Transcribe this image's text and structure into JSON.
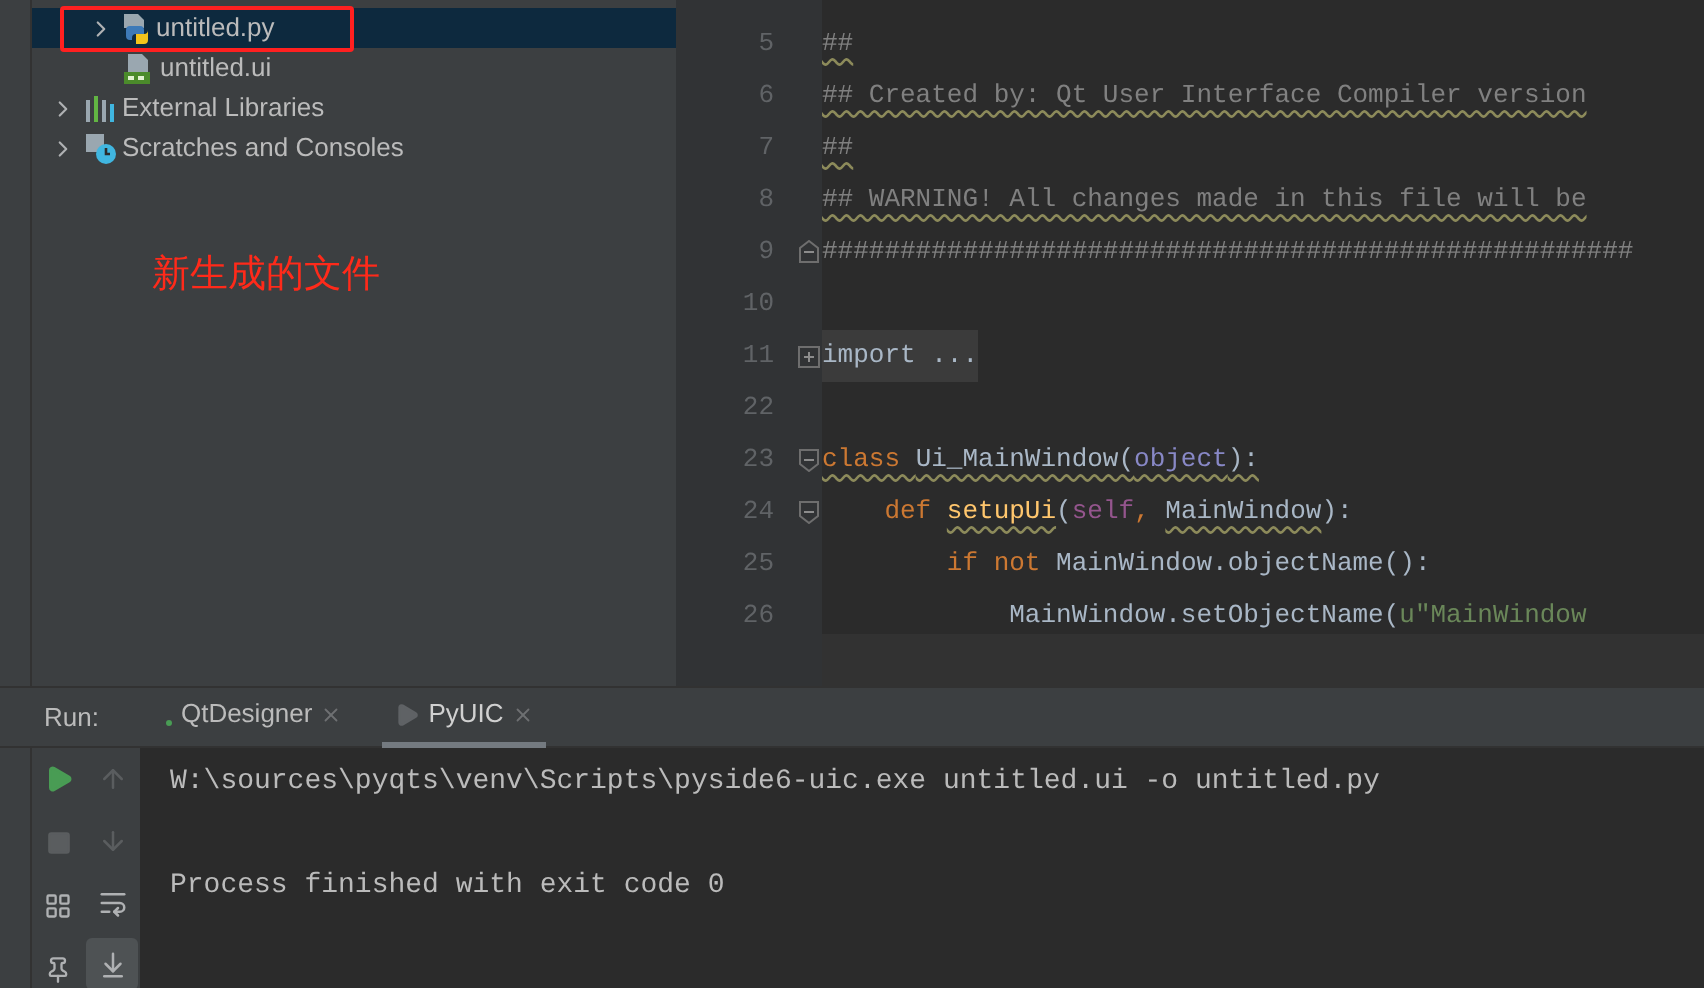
{
  "project_tree": {
    "nested_items": [
      {
        "label": "untitled.py",
        "kind": "python",
        "expanded": false,
        "selected": true,
        "boxed": true
      },
      {
        "label": "untitled.ui",
        "kind": "qt",
        "selected": false,
        "boxed": false
      }
    ],
    "root_items": [
      {
        "label": "External Libraries",
        "kind": "libraries",
        "expanded": false,
        "selected": false,
        "boxed": false
      },
      {
        "label": "Scratches and Consoles",
        "kind": "scratches",
        "expanded": false,
        "selected": false,
        "boxed": false
      }
    ]
  },
  "annotation": {
    "text": "新生成的文件",
    "color": "#ff2a1a"
  },
  "editor": {
    "lines": [
      {
        "number": "5",
        "kind": "plain",
        "tokens": [
          {
            "text": "##",
            "kind": "comment",
            "squiggle": true
          }
        ]
      },
      {
        "number": "6",
        "kind": "plain",
        "tokens": [
          {
            "text": "## Created by: Qt User Interface Compiler version",
            "kind": "comment",
            "squiggle": true
          }
        ]
      },
      {
        "number": "7",
        "kind": "plain",
        "tokens": [
          {
            "text": "##",
            "kind": "comment",
            "squiggle": true
          }
        ]
      },
      {
        "number": "8",
        "kind": "plain",
        "tokens": [
          {
            "text": "## WARNING! All changes made in this file will be",
            "kind": "comment",
            "squiggle": true
          }
        ]
      },
      {
        "number": "9",
        "kind": "fold_end",
        "tokens": [
          {
            "text": "####################################################",
            "kind": "comment",
            "squiggle": false
          }
        ]
      },
      {
        "number": "10",
        "kind": "plain"
      },
      {
        "number": "11",
        "kind": "folded",
        "tokens": [
          {
            "text": "import ...",
            "kind": "name",
            "squiggle": false
          }
        ]
      },
      {
        "number": "22",
        "kind": "plain"
      },
      {
        "number": "23",
        "kind": "fold_start",
        "tokens": [
          {
            "text": "class ",
            "kind": "keyword",
            "squiggle": true
          },
          {
            "text": "Ui_MainWindow(",
            "kind": "name",
            "squiggle": true
          },
          {
            "text": "object",
            "kind": "builtin",
            "squiggle": true
          },
          {
            "text": "):",
            "kind": "name",
            "squiggle": true
          }
        ]
      },
      {
        "number": "24",
        "kind": "fold_start",
        "tokens": [
          {
            "text": "    def ",
            "kind": "keyword",
            "squiggle": false
          },
          {
            "text": "setupUi",
            "kind": "function",
            "squiggle": true
          },
          {
            "text": "(",
            "kind": "name",
            "squiggle": false
          },
          {
            "text": "self",
            "kind": "self",
            "squiggle": false
          },
          {
            "text": ", ",
            "kind": "keyword",
            "squiggle": false
          },
          {
            "text": "MainWindow",
            "kind": "name",
            "squiggle": true
          },
          {
            "text": "):",
            "kind": "name",
            "squiggle": false
          }
        ]
      },
      {
        "number": "25",
        "kind": "plain",
        "tokens": [
          {
            "text": "        if not ",
            "kind": "keyword",
            "squiggle": false
          },
          {
            "text": "MainWindow.objectName():",
            "kind": "name",
            "squiggle": false
          }
        ]
      },
      {
        "number": "26",
        "kind": "plain",
        "tokens": [
          {
            "text": "            MainWindow.setObjectName(",
            "kind": "name",
            "squiggle": false
          },
          {
            "text": "u\"MainWindow",
            "kind": "string",
            "squiggle": false
          }
        ]
      }
    ]
  },
  "run_panel": {
    "label": "Run:",
    "tabs": [
      {
        "label": "QtDesigner",
        "kind": "dot",
        "selected": false
      },
      {
        "label": "PyUIC",
        "kind": "play",
        "selected": true
      }
    ],
    "run_tools": [
      {
        "kind": "rerun",
        "disabled": false
      },
      {
        "kind": "stop",
        "disabled": true
      },
      {
        "kind": "layout",
        "disabled": false
      },
      {
        "kind": "pin",
        "disabled": false
      }
    ],
    "console_tools": [
      {
        "kind": "up",
        "on": false,
        "disabled": true
      },
      {
        "kind": "down",
        "on": false,
        "disabled": true
      },
      {
        "kind": "wrap",
        "on": false,
        "disabled": false
      },
      {
        "kind": "scroll_end",
        "on": true,
        "disabled": false
      }
    ],
    "console": {
      "command": "W:\\sources\\pyqts\\venv\\Scripts\\pyside6-uic.exe untitled.ui -o untitled.py",
      "message": "Process finished with exit code 0"
    }
  }
}
